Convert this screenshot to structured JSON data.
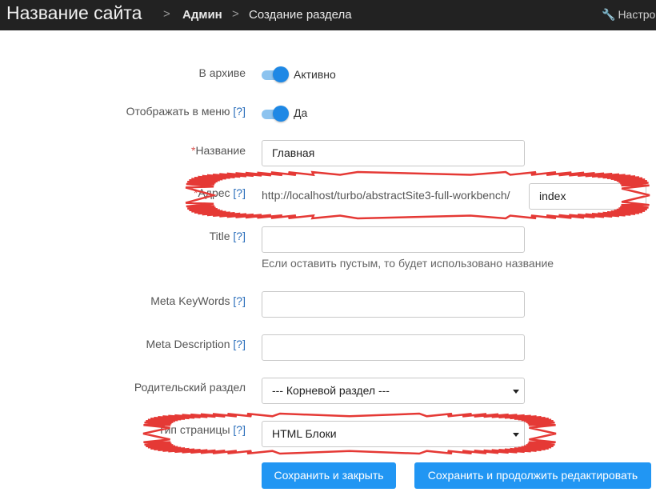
{
  "header": {
    "site_title": "Название сайта",
    "breadcrumbs": [
      "Админ",
      "Создание раздела"
    ],
    "separator": ">",
    "settings_label": "Настро",
    "settings_icon": "wrench-icon"
  },
  "form": {
    "help_mark": "[?]",
    "archive": {
      "label": "В архиве",
      "toggle_text": "Активно",
      "on": true
    },
    "show_in_menu": {
      "label": "Отображать в меню",
      "toggle_text": "Да",
      "on": true
    },
    "name": {
      "required_mark": "*",
      "label": "Название",
      "value": "Главная"
    },
    "address": {
      "required_mark": "*",
      "label": "Адрес",
      "prefix": "http://localhost/turbo/abstractSite3-full-workbench/",
      "value": "index"
    },
    "title": {
      "label": "Title",
      "value": "",
      "hint": "Если оставить пустым, то будет использовано название"
    },
    "meta_keywords": {
      "label": "Meta KeyWords",
      "value": ""
    },
    "meta_description": {
      "label": "Meta Description",
      "value": ""
    },
    "parent": {
      "label": "Родительский раздел",
      "selected": "--- Корневой раздел ---"
    },
    "page_type": {
      "label": "Тип страницы",
      "selected": "HTML Блоки"
    }
  },
  "buttons": {
    "save_close": "Сохранить и закрыть",
    "save_continue": "Сохранить и продолжить редактировать"
  },
  "colors": {
    "header_bg": "#222222",
    "accent": "#2196f3",
    "highlight": "#e53935",
    "required": "#d9534f",
    "help_link": "#2a6ebb"
  }
}
